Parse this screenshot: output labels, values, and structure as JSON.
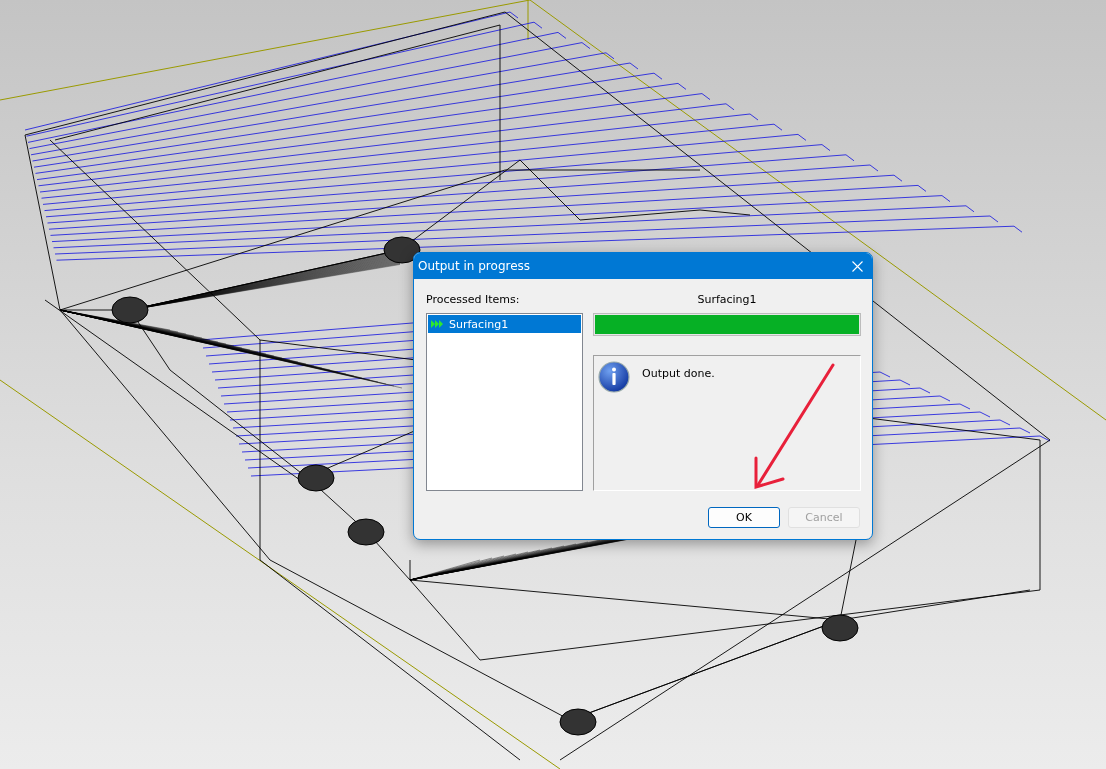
{
  "dialog": {
    "title": "Output in progress",
    "list_label": "Processed Items:",
    "items": [
      {
        "label": "Surfacing1",
        "selected": true
      }
    ],
    "current_item": "Surfacing1",
    "progress": {
      "level": 1
    },
    "message": "Output done.",
    "buttons": [
      {
        "label": "OK",
        "disabled": false,
        "default": true
      },
      {
        "label": "Cancel",
        "disabled": true,
        "default": false
      }
    ]
  }
}
